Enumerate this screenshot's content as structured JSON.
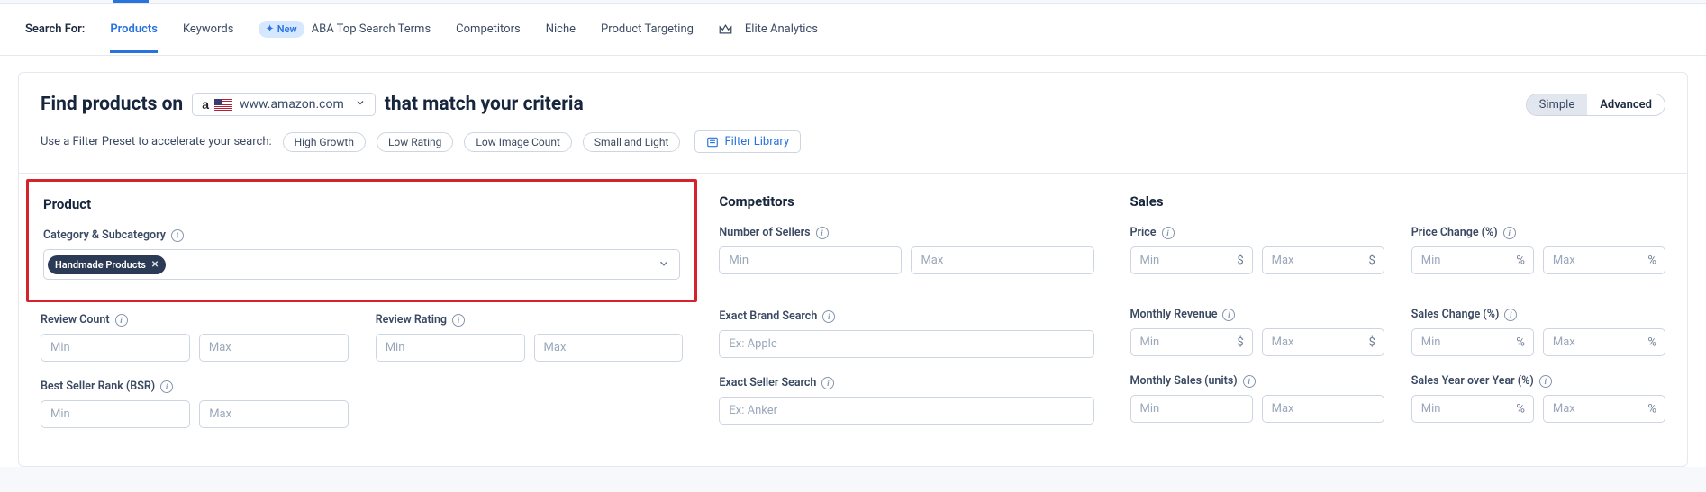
{
  "tabs": {
    "search_for": "Search For:",
    "products": "Products",
    "keywords": "Keywords",
    "new_badge": "New",
    "aba": "ABA Top Search Terms",
    "competitors": "Competitors",
    "niche": "Niche",
    "product_targeting": "Product Targeting",
    "elite": "Elite Analytics"
  },
  "header": {
    "title_prefix": "Find products on",
    "market_domain": "www.amazon.com",
    "title_suffix": "that match your criteria",
    "mode_simple": "Simple",
    "mode_advanced": "Advanced"
  },
  "presets": {
    "label": "Use a Filter Preset to accelerate your search:",
    "high_growth": "High Growth",
    "low_rating": "Low Rating",
    "low_image": "Low Image Count",
    "small_light": "Small and Light",
    "library": "Filter Library"
  },
  "common": {
    "min": "Min",
    "max": "Max",
    "dollar": "$",
    "percent": "%"
  },
  "product": {
    "section": "Product",
    "category_label": "Category & Subcategory",
    "selected_tag": "Handmade Products",
    "review_count": "Review Count",
    "review_rating": "Review Rating",
    "bsr": "Best Seller Rank (BSR)"
  },
  "competitors": {
    "section": "Competitors",
    "num_sellers": "Number of Sellers",
    "exact_brand": "Exact Brand Search",
    "brand_ph": "Ex: Apple",
    "exact_seller": "Exact Seller Search",
    "seller_ph": "Ex: Anker"
  },
  "sales": {
    "section": "Sales",
    "price": "Price",
    "price_change": "Price Change (%)",
    "monthly_revenue": "Monthly Revenue",
    "sales_change": "Sales Change (%)",
    "monthly_sales": "Monthly Sales (units)",
    "sales_yoy": "Sales Year over Year (%)"
  }
}
